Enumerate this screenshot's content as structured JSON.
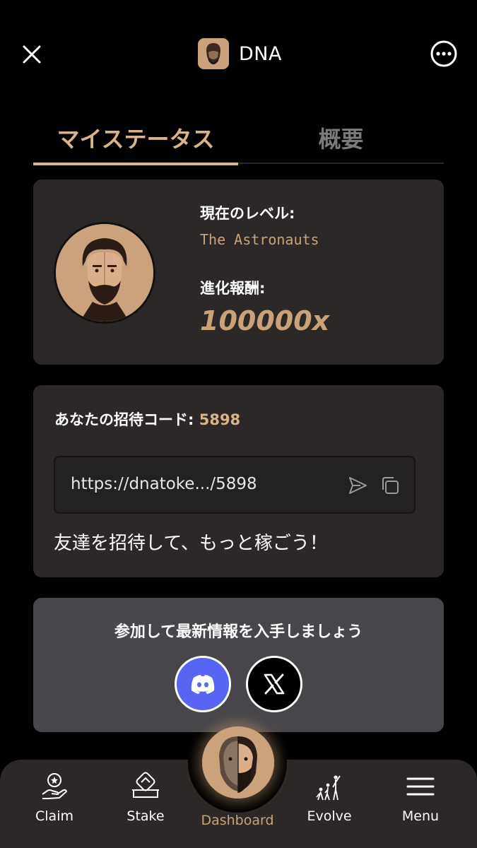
{
  "header": {
    "title": "DNA",
    "close_icon": "close-icon",
    "more_icon": "more-options-icon"
  },
  "tabs": [
    {
      "label": "マイステータス",
      "active": true
    },
    {
      "label": "概要",
      "active": false
    }
  ],
  "level_card": {
    "current_level_label": "現在のレベル:",
    "current_level_value": "The Astronauts",
    "evolution_reward_label": "進化報酬:",
    "evolution_reward_value": "100000x"
  },
  "invite_card": {
    "label": "あなたの招待コード:",
    "code": "5898",
    "link": "https://dnatoke.../5898",
    "note": "友達を招待して、もっと稼ごう！"
  },
  "social_card": {
    "title": "参加して最新情報を入手しましょう",
    "buttons": [
      "discord-icon",
      "x-icon"
    ]
  },
  "bottom_nav": {
    "items": [
      {
        "label": "Claim",
        "icon": "claim-icon"
      },
      {
        "label": "Stake",
        "icon": "stake-icon"
      },
      {
        "label": "Dashboard",
        "icon": "dashboard-avatar",
        "active": true
      },
      {
        "label": "Evolve",
        "icon": "evolve-icon"
      },
      {
        "label": "Menu",
        "icon": "menu-icon"
      }
    ]
  },
  "colors": {
    "background": "#000000",
    "card": "#2b2827",
    "social_card": "#48464a",
    "accent": "#d8b48a",
    "discord": "#5865f2"
  }
}
